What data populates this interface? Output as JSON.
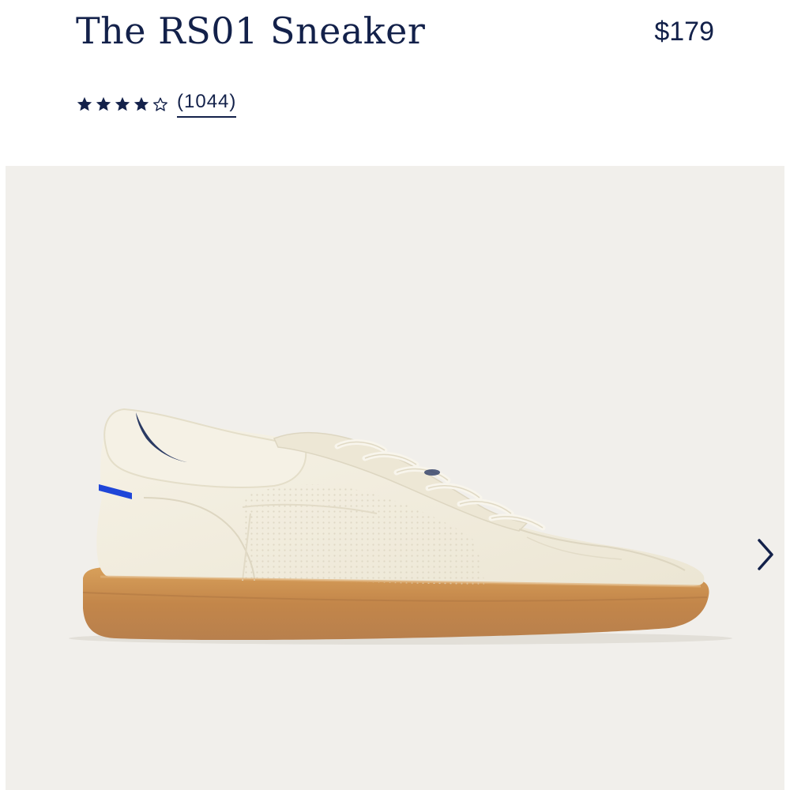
{
  "product": {
    "title": "The RS01 Sneaker",
    "price": "$179"
  },
  "rating": {
    "value": 4,
    "max": 5,
    "review_count_label": "(1044)",
    "star_color": "#13214a"
  },
  "gallery": {
    "background_color": "#f1efeb",
    "image_subject": "sneaker-image",
    "next_icon": "chevron-right-icon"
  },
  "colors": {
    "text": "#13214a",
    "upper": "#f3efe3",
    "sole": "#c88a47",
    "accent_blue": "#1f46d8"
  }
}
